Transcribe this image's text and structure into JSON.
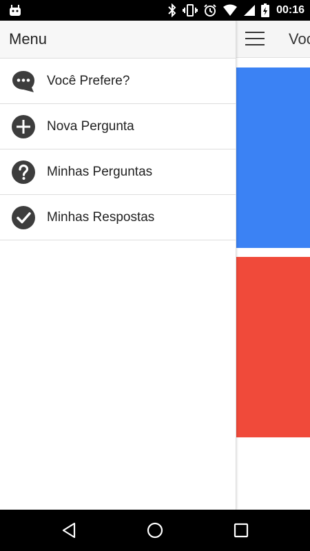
{
  "status_bar": {
    "time": "00:16"
  },
  "toolbar": {
    "title": "Você Prefere?"
  },
  "drawer": {
    "title": "Menu",
    "items": [
      {
        "label": "Você Prefere?",
        "icon": "chat-bubble-icon"
      },
      {
        "label": "Nova Pergunta",
        "icon": "add-circle-icon"
      },
      {
        "label": "Minhas Perguntas",
        "icon": "help-circle-icon"
      },
      {
        "label": "Minhas Respostas",
        "icon": "check-circle-icon"
      }
    ]
  },
  "colors": {
    "option_a": "#3b82f4",
    "option_b": "#f04a3a",
    "icon": "#3d3d3d"
  }
}
